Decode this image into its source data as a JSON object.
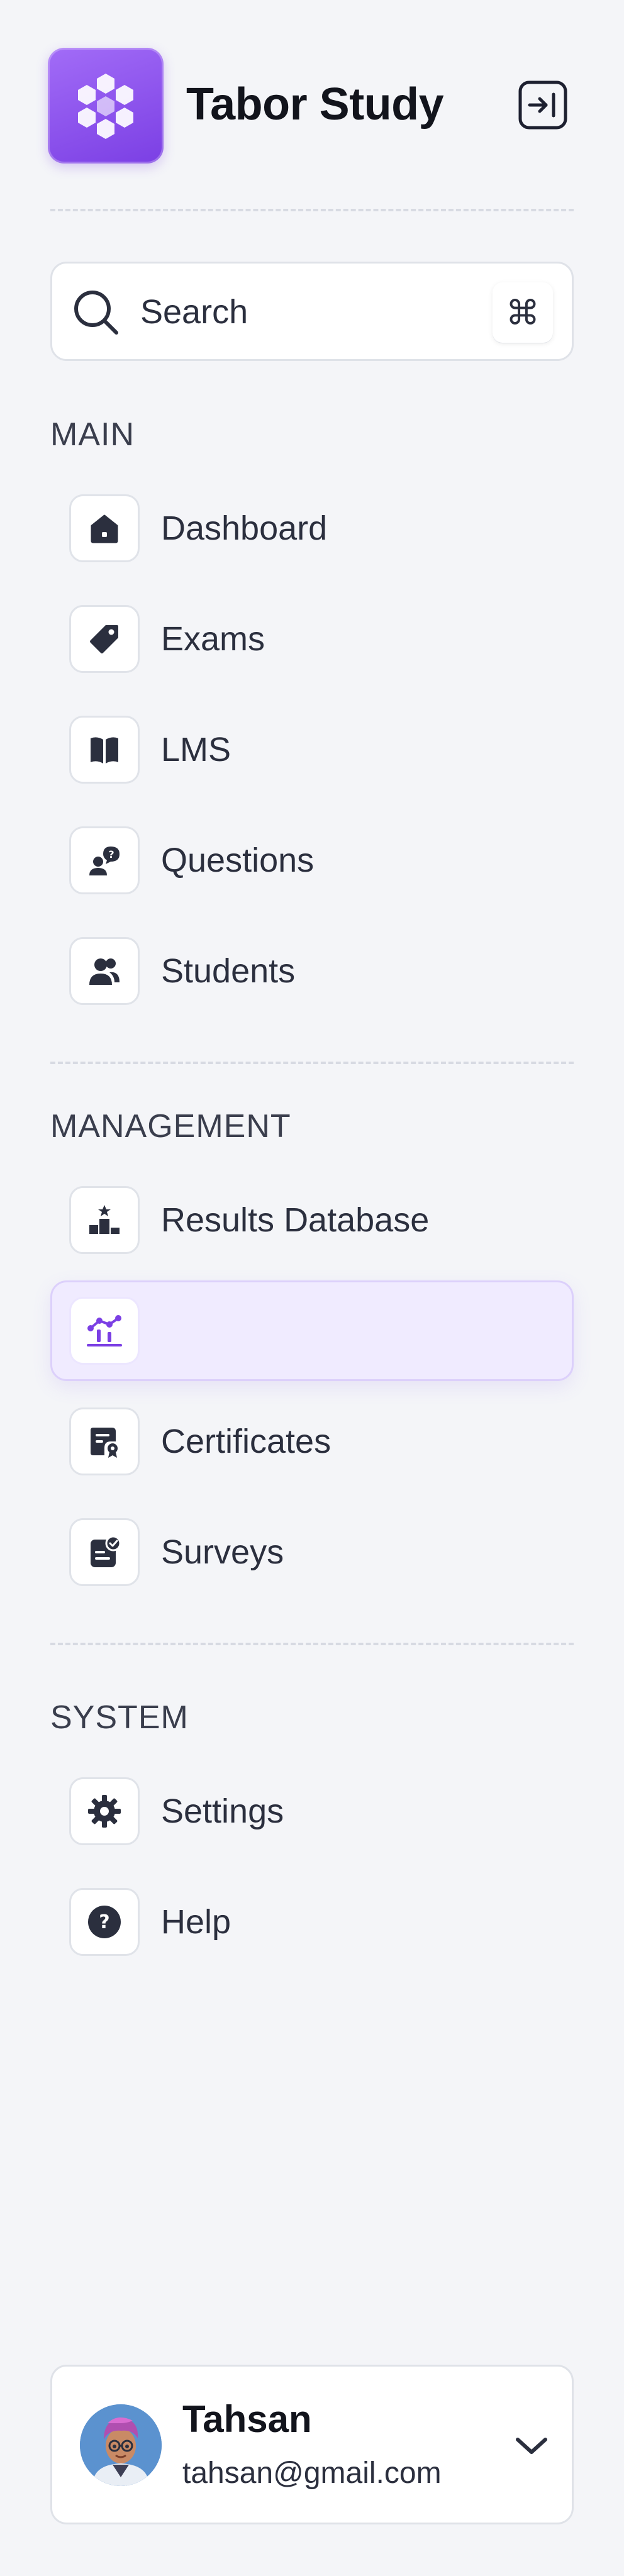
{
  "brand": {
    "title": "Tabor Study",
    "accent": "#7b3fe4"
  },
  "search": {
    "placeholder": "Search",
    "shortcut": "⌘"
  },
  "sections": [
    {
      "label": "MAIN",
      "items": [
        {
          "label": "Dashboard",
          "icon": "home-icon"
        },
        {
          "label": "Exams",
          "icon": "tag-icon"
        },
        {
          "label": "LMS",
          "icon": "book-icon"
        },
        {
          "label": "Questions",
          "icon": "user-question-icon"
        },
        {
          "label": "Students",
          "icon": "users-icon"
        }
      ]
    },
    {
      "label": "MANAGEMENT",
      "items": [
        {
          "label": "Results Database",
          "icon": "podium-icon"
        },
        {
          "label": "",
          "icon": "chart-icon",
          "active": true
        },
        {
          "label": "Certificates",
          "icon": "certificate-icon"
        },
        {
          "label": "Surveys",
          "icon": "survey-icon"
        }
      ]
    },
    {
      "label": "SYSTEM",
      "items": [
        {
          "label": "Settings",
          "icon": "gear-icon"
        },
        {
          "label": "Help",
          "icon": "help-icon"
        }
      ]
    }
  ],
  "user": {
    "name": "Tahsan",
    "email": "tahsan@gmail.com",
    "avatar_icon": "avatar-icon"
  }
}
